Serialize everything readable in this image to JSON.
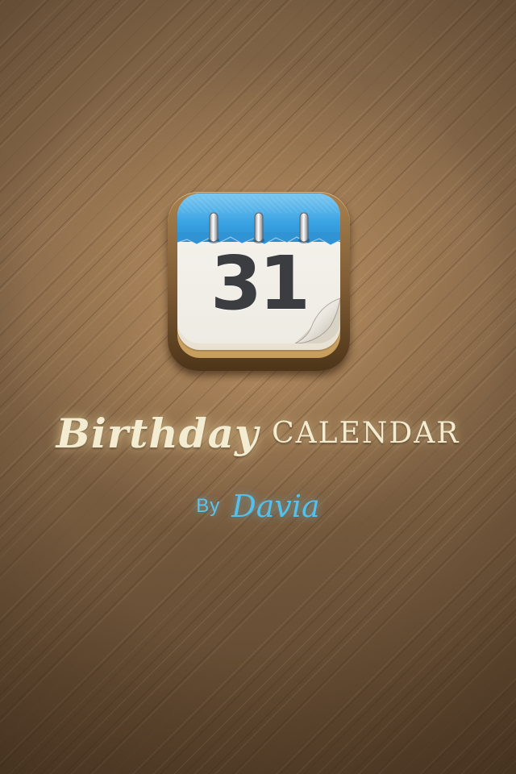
{
  "splash": {
    "app_icon": {
      "icon": "calendar-icon",
      "day_number": "31",
      "accent_color": "#3aa3e4"
    },
    "title_script": "Birthday",
    "title_caps": "CALENDAR",
    "by_label": "By",
    "brand_name": "Davia",
    "colors": {
      "background": "#7a5e41",
      "title": "#f4ecd0",
      "brand": "#56c0ec"
    }
  }
}
